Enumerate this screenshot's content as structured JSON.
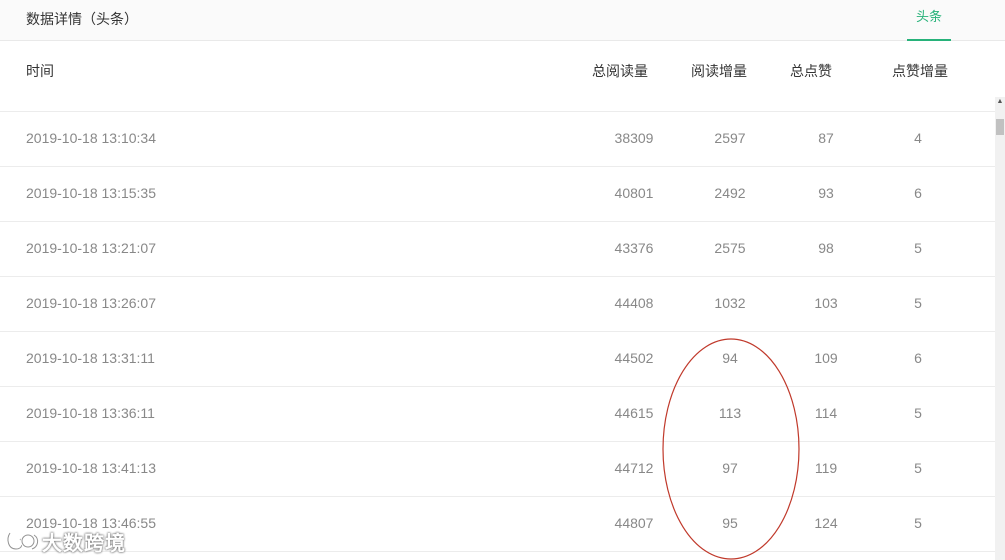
{
  "header": {
    "title": "数据详情（头条）",
    "active_tab": "头条"
  },
  "table": {
    "columns": [
      "时间",
      "总阅读量",
      "阅读增量",
      "总点赞",
      "点赞增量"
    ],
    "rows": [
      {
        "time": "2019-10-18 13:10:34",
        "total_reads": "38309",
        "read_increase": "2597",
        "total_likes": "87",
        "like_increase": "4"
      },
      {
        "time": "2019-10-18 13:15:35",
        "total_reads": "40801",
        "read_increase": "2492",
        "total_likes": "93",
        "like_increase": "6"
      },
      {
        "time": "2019-10-18 13:21:07",
        "total_reads": "43376",
        "read_increase": "2575",
        "total_likes": "98",
        "like_increase": "5"
      },
      {
        "time": "2019-10-18 13:26:07",
        "total_reads": "44408",
        "read_increase": "1032",
        "total_likes": "103",
        "like_increase": "5"
      },
      {
        "time": "2019-10-18 13:31:11",
        "total_reads": "44502",
        "read_increase": "94",
        "total_likes": "109",
        "like_increase": "6"
      },
      {
        "time": "2019-10-18 13:36:11",
        "total_reads": "44615",
        "read_increase": "113",
        "total_likes": "114",
        "like_increase": "5"
      },
      {
        "time": "2019-10-18 13:41:13",
        "total_reads": "44712",
        "read_increase": "97",
        "total_likes": "119",
        "like_increase": "5"
      },
      {
        "time": "2019-10-18 13:46:55",
        "total_reads": "44807",
        "read_increase": "95",
        "total_likes": "124",
        "like_increase": "5"
      }
    ]
  },
  "colors": {
    "accent": "#27b27a",
    "annotation": "#c0392b",
    "cell_text": "#888888",
    "header_text": "#333333"
  },
  "annotation": {
    "shape": "ellipse",
    "highlights": "阅读增量 rows 5-8"
  },
  "watermark": {
    "text": "大数跨境",
    "icon": "logo-icon"
  }
}
